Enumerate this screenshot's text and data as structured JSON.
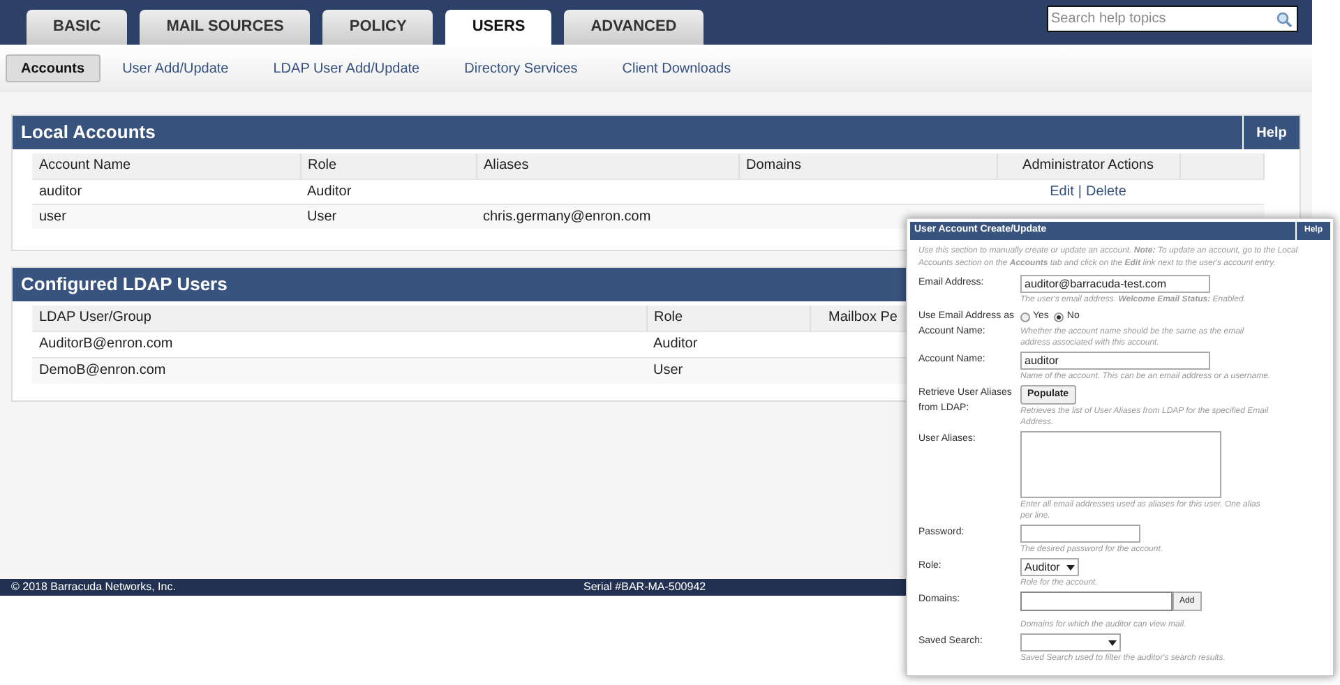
{
  "top_tabs": [
    {
      "label": "BASIC",
      "selected": false
    },
    {
      "label": "MAIL SOURCES",
      "selected": false
    },
    {
      "label": "POLICY",
      "selected": false
    },
    {
      "label": "USERS",
      "selected": true
    },
    {
      "label": "ADVANCED",
      "selected": false
    }
  ],
  "search": {
    "placeholder": "Search help topics"
  },
  "sub_tabs": [
    {
      "label": "Accounts",
      "selected": true
    },
    {
      "label": "User Add/Update",
      "selected": false
    },
    {
      "label": "LDAP User Add/Update",
      "selected": false
    },
    {
      "label": "Directory Services",
      "selected": false
    },
    {
      "label": "Client Downloads",
      "selected": false
    }
  ],
  "local_accounts": {
    "title": "Local Accounts",
    "help": "Help",
    "columns": [
      "Account Name",
      "Role",
      "Aliases",
      "Domains",
      "Administrator Actions"
    ],
    "rows": [
      {
        "cells": [
          "auditor",
          "Auditor",
          "",
          ""
        ],
        "edit": "Edit",
        "separator": "|",
        "delete": "Delete"
      },
      {
        "cells": [
          "user",
          "User",
          "chris.germany@enron.com",
          ""
        ]
      }
    ]
  },
  "ldap_users": {
    "title": "Configured LDAP Users",
    "columns": [
      "LDAP User/Group",
      "Role",
      "Mailbox Pe"
    ],
    "rows": [
      {
        "cells": [
          "AuditorB@enron.com",
          "Auditor"
        ]
      },
      {
        "cells": [
          "DemoB@enron.com",
          "User"
        ]
      }
    ]
  },
  "footer": {
    "copyright": "© 2018 Barracuda Networks, Inc.",
    "serial": "Serial #BAR-MA-500942"
  },
  "dialog": {
    "title": "User Account Create/Update",
    "help": "Help",
    "intro": "Use this section to manually create or update an account. **Note:** To update an account, go to the Local Accounts section on the **Accounts** tab and click on the **Edit** link next to the user's account entry.",
    "fields": [
      {
        "kind": "text",
        "label": "Email Address:",
        "value": "auditor@barracuda-test.com",
        "hint": "The user's email address. **Welcome Email Status:** Enabled."
      },
      {
        "kind": "radio",
        "label": "Use Email Address as Account Name:",
        "options": [
          {
            "label": "Yes",
            "selected": false
          },
          {
            "label": "No",
            "selected": true
          }
        ],
        "hint": "Whether the account name should be the same as the email address associated with this account."
      },
      {
        "kind": "text",
        "label": "Account Name:",
        "value": "auditor",
        "hint": "Name of the account. This can be an email address or a username."
      },
      {
        "kind": "button",
        "label": "Retrieve User Aliases from LDAP:",
        "button": "Populate",
        "hint": "Retrieves the list of User Aliases from LDAP for the specified Email Address."
      },
      {
        "kind": "textarea",
        "label": "User Aliases:",
        "hint": "Enter all email addresses used as aliases for this user. One alias per line."
      },
      {
        "kind": "password",
        "label": "Password:",
        "hint": "The desired password for the account."
      },
      {
        "kind": "select",
        "label": "Role:",
        "value": "Auditor",
        "hint": "Role for the account."
      },
      {
        "kind": "add",
        "label": "Domains:",
        "button": "Add",
        "hint": "Domains for which the auditor can view mail."
      },
      {
        "kind": "select",
        "label": "Saved Search:",
        "hint": "Saved Search used to filter the auditor's search results."
      }
    ]
  }
}
